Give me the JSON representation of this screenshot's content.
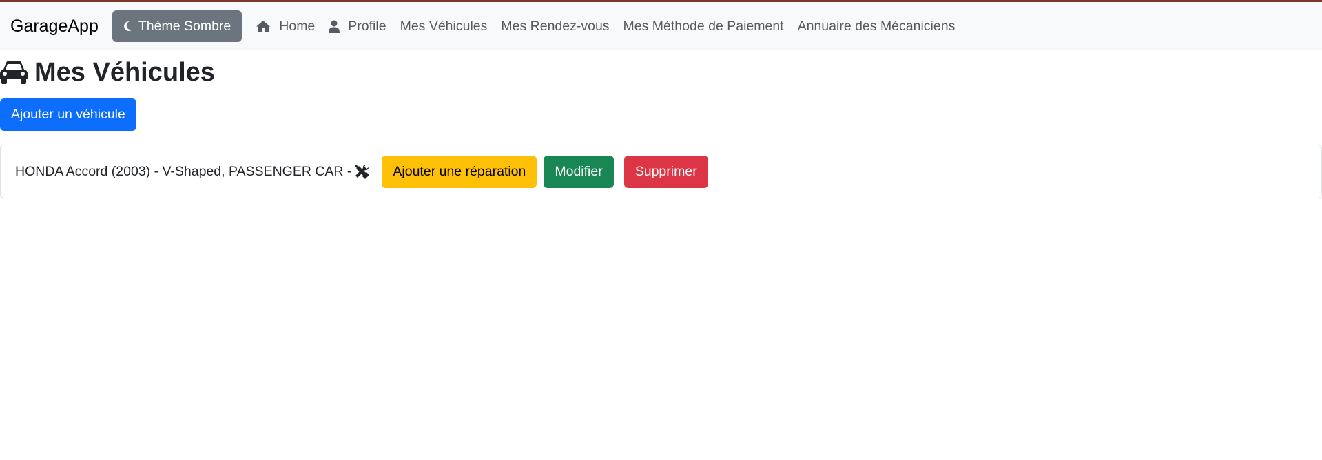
{
  "navbar": {
    "brand": "GarageApp",
    "theme_button": {
      "label": "Thème Sombre",
      "icon": "moon-icon"
    },
    "links": [
      {
        "label": "Home",
        "icon": "home-icon"
      },
      {
        "label": "Profile",
        "icon": "user-icon"
      },
      {
        "label": "Mes Véhicules"
      },
      {
        "label": "Mes Rendez-vous"
      },
      {
        "label": "Mes Méthode de Paiement"
      },
      {
        "label": "Annuaire des Mécaniciens"
      }
    ]
  },
  "main": {
    "title": "Mes Véhicules",
    "title_icon": "car-icon",
    "add_vehicle_label": "Ajouter un véhicule",
    "vehicles": [
      {
        "description": "HONDA Accord (2003) - V-Shaped, PASSENGER CAR -",
        "icon": "tools-icon",
        "add_repair_label": "Ajouter une réparation",
        "edit_label": "Modifier",
        "delete_label": "Supprimer"
      }
    ]
  },
  "colors": {
    "primary": "#0d6efd",
    "secondary": "#6c757d",
    "warning": "#ffc107",
    "success": "#198754",
    "danger": "#dc3545",
    "navbar_bg": "#f8f9fa"
  }
}
